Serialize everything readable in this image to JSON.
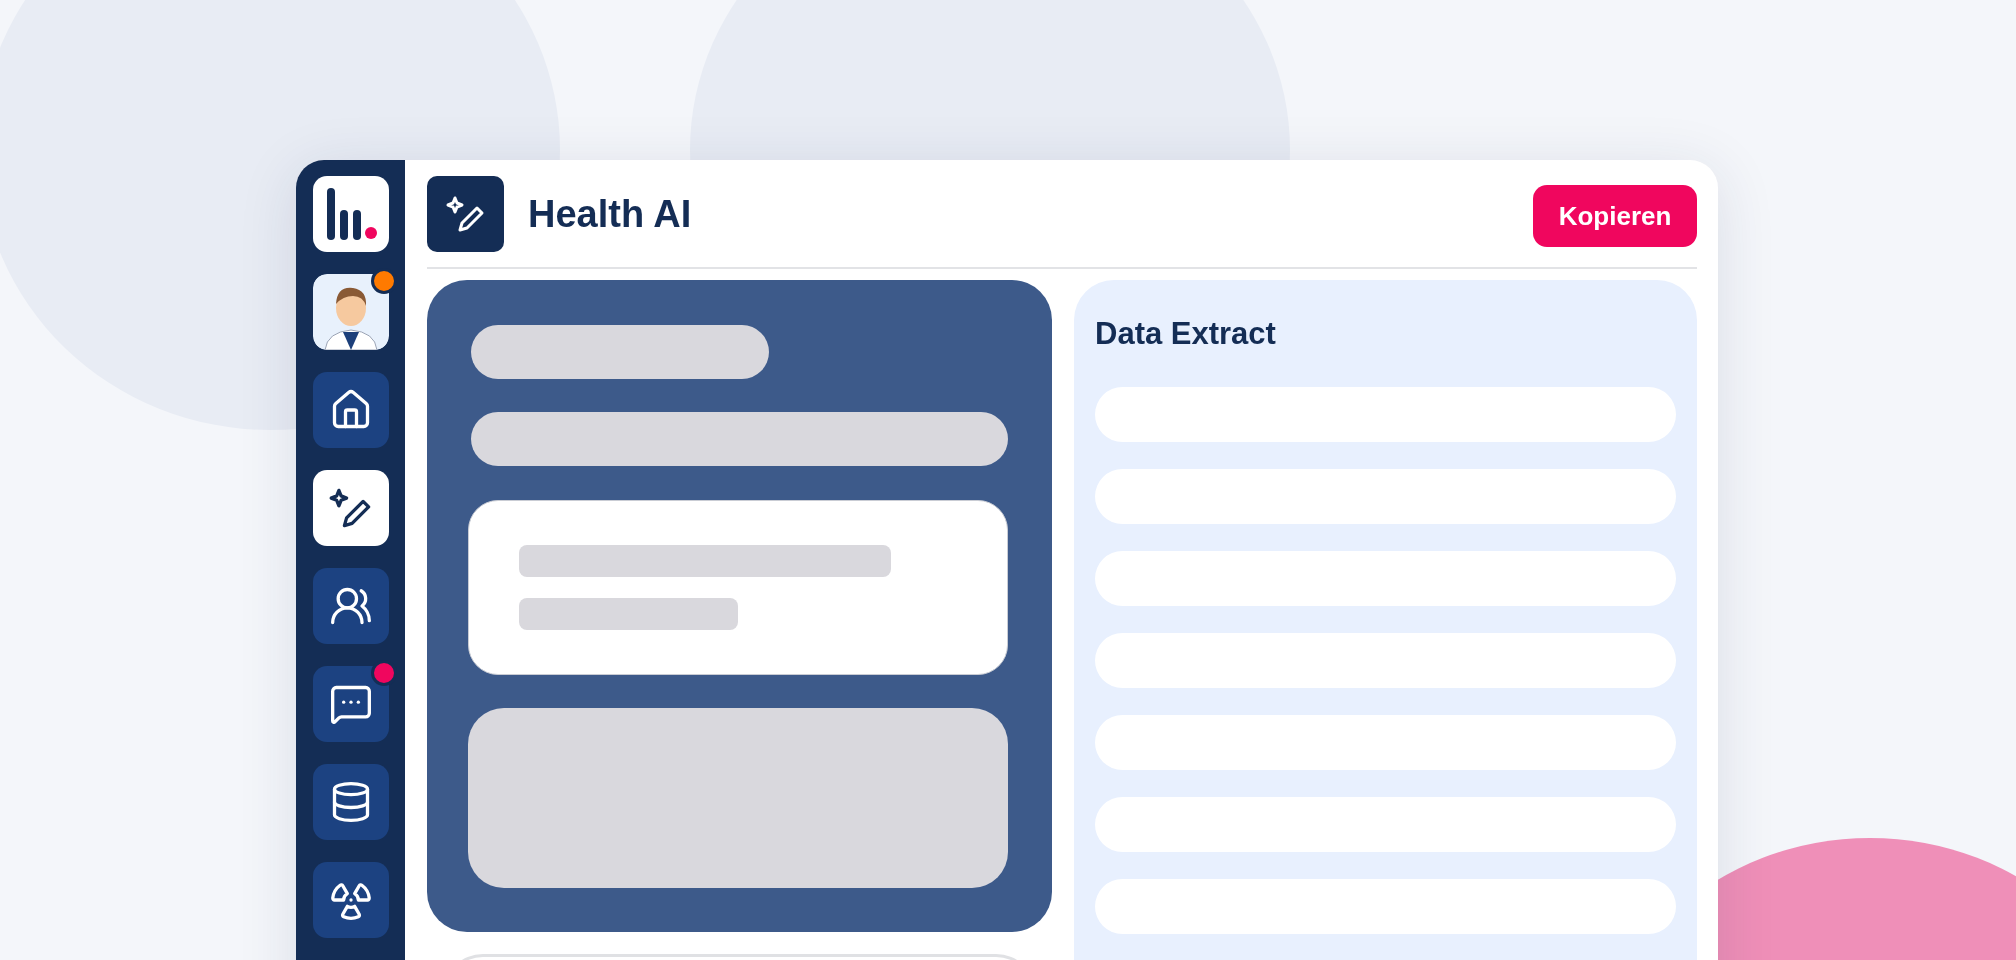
{
  "sidebar": {
    "avatar": {
      "badge": {
        "color": "#ff7a00"
      }
    },
    "nav": [
      {
        "selected": false
      },
      {
        "selected": true
      },
      {
        "selected": false
      },
      {
        "selected": false,
        "badge": {
          "color": "#f0065e"
        }
      },
      {
        "selected": false
      },
      {
        "selected": false
      }
    ]
  },
  "header": {
    "title": "Health AI",
    "button": "Kopieren"
  },
  "data_extract": {
    "title": "Data Extract"
  }
}
